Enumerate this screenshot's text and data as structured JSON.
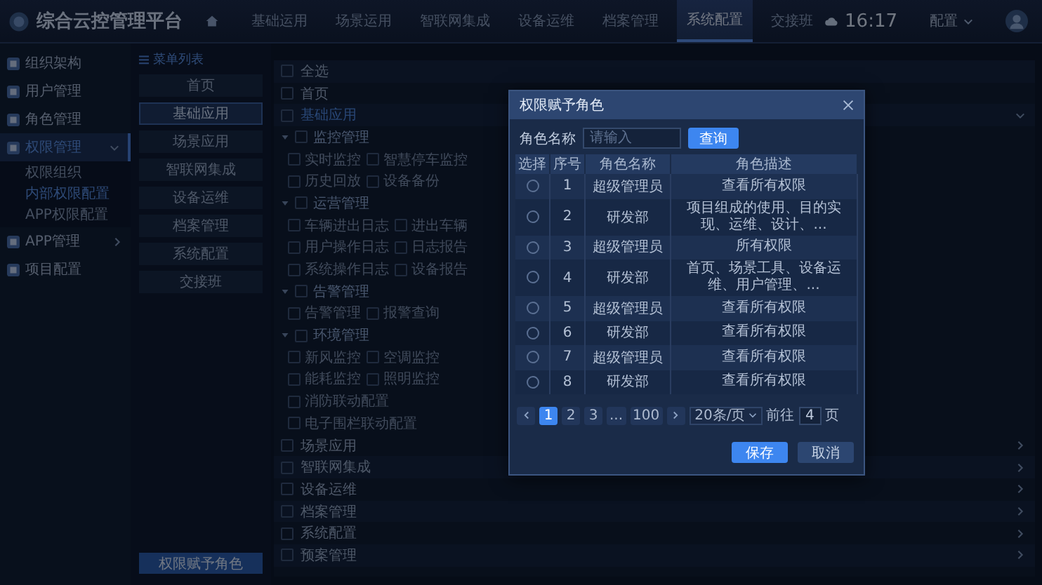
{
  "header": {
    "logo": "综合云控管理平台",
    "nav": [
      {
        "label": "基础运用",
        "selected": false
      },
      {
        "label": "场景运用",
        "selected": false
      },
      {
        "label": "智联网集成",
        "selected": false
      },
      {
        "label": "设备运维",
        "selected": false
      },
      {
        "label": "档案管理",
        "selected": false
      },
      {
        "label": "系统配置",
        "selected": true
      },
      {
        "label": "交接班",
        "selected": false
      }
    ],
    "time": "16:17",
    "user_menu": "配置"
  },
  "sidebar": {
    "items": [
      {
        "label": "组织架构",
        "selected": false
      },
      {
        "label": "用户管理",
        "selected": false
      },
      {
        "label": "角色管理",
        "selected": false
      },
      {
        "label": "权限管理",
        "selected": true,
        "expanded": true,
        "children": [
          {
            "label": "权限组织",
            "selected": false
          },
          {
            "label": "内部权限配置",
            "selected": true
          },
          {
            "label": "APP权限配置",
            "selected": false
          }
        ]
      },
      {
        "label": "APP管理",
        "selected": false,
        "expanded": false
      },
      {
        "label": "项目配置",
        "selected": false
      }
    ]
  },
  "menu_list": {
    "title": "菜单列表",
    "items": [
      {
        "label": "首页",
        "selected": false
      },
      {
        "label": "基础应用",
        "selected": true
      },
      {
        "label": "场景应用",
        "selected": false
      },
      {
        "label": "智联网集成",
        "selected": false
      },
      {
        "label": "设备运维",
        "selected": false
      },
      {
        "label": "档案管理",
        "selected": false
      },
      {
        "label": "系统配置",
        "selected": false
      },
      {
        "label": "交接班",
        "selected": false
      }
    ],
    "assign_button": "权限赋予角色"
  },
  "permissions": {
    "rows": [
      {
        "kind": "plain",
        "label": "全选",
        "checked": false
      },
      {
        "kind": "plain",
        "label": "首页",
        "checked": false
      },
      {
        "kind": "module",
        "label": "基础应用",
        "checked": false,
        "expanded": true,
        "groups": [
          {
            "label": "监控管理",
            "checked": false,
            "expanded": true,
            "lines": [
              {
                "items": [
                  {
                    "label": "实时监控",
                    "checked": false
                  },
                  {
                    "label": "智慧停车监控",
                    "checked": false
                  }
                ]
              },
              {
                "items": [
                  {
                    "label": "历史回放",
                    "checked": false
                  },
                  {
                    "label": "设备备份",
                    "checked": false
                  }
                ]
              }
            ]
          },
          {
            "label": "运营管理",
            "checked": false,
            "expanded": true,
            "lines": [
              {
                "items": [
                  {
                    "label": "车辆进出日志",
                    "checked": false
                  },
                  {
                    "label": "进出车辆",
                    "checked": false
                  }
                ]
              },
              {
                "items": [
                  {
                    "label": "用户操作日志",
                    "checked": false
                  },
                  {
                    "label": "日志报告",
                    "checked": false
                  }
                ]
              },
              {
                "items": [
                  {
                    "label": "系统操作日志",
                    "checked": false
                  },
                  {
                    "label": "设备报告",
                    "checked": false
                  }
                ]
              }
            ]
          },
          {
            "label": "告警管理",
            "checked": false,
            "expanded": true,
            "lines": [
              {
                "items": [
                  {
                    "label": "告警管理",
                    "checked": false
                  },
                  {
                    "label": "报警查询",
                    "checked": false
                  }
                ]
              }
            ]
          },
          {
            "label": "环境管理",
            "checked": false,
            "expanded": true,
            "lines": [
              {
                "items": [
                  {
                    "label": "新风监控",
                    "checked": false
                  },
                  {
                    "label": "空调监控",
                    "checked": false
                  }
                ]
              },
              {
                "items": [
                  {
                    "label": "能耗监控",
                    "checked": false
                  },
                  {
                    "label": "照明监控",
                    "checked": false
                  }
                ]
              },
              {
                "items": [
                  {
                    "label": "消防联动配置",
                    "checked": false
                  }
                ]
              },
              {
                "items": [
                  {
                    "label": "电子围栏联动配置",
                    "checked": false
                  }
                ]
              }
            ]
          }
        ]
      },
      {
        "kind": "module",
        "label": "场景应用",
        "checked": false,
        "expanded": false
      },
      {
        "kind": "module",
        "label": "智联网集成",
        "checked": false,
        "expanded": false
      },
      {
        "kind": "module",
        "label": "设备运维",
        "checked": false,
        "expanded": false
      },
      {
        "kind": "module",
        "label": "档案管理",
        "checked": false,
        "expanded": false
      },
      {
        "kind": "module",
        "label": "系统配置",
        "checked": false,
        "expanded": false
      },
      {
        "kind": "module",
        "label": "预案管理",
        "checked": false,
        "expanded": false
      }
    ]
  },
  "dialog": {
    "title": "权限赋予角色",
    "search": {
      "label": "角色名称",
      "placeholder": "请输入",
      "button": "查询"
    },
    "table": {
      "columns": [
        "选择",
        "序号",
        "角色名称",
        "角色描述"
      ],
      "rows": [
        {
          "selected": false,
          "cells": [
            "",
            "1",
            "超级管理员",
            "查看所有权限"
          ]
        },
        {
          "selected": false,
          "cells": [
            "",
            "2",
            "研发部",
            "项目组成的使用、目的实现、运维、设计、..."
          ]
        },
        {
          "selected": false,
          "cells": [
            "",
            "3",
            "超级管理员",
            "所有权限"
          ]
        },
        {
          "selected": false,
          "cells": [
            "",
            "4",
            "研发部",
            "首页、场景工具、设备运维、用户管理、..."
          ]
        },
        {
          "selected": false,
          "cells": [
            "",
            "5",
            "超级管理员",
            "查看所有权限"
          ]
        },
        {
          "selected": false,
          "cells": [
            "",
            "6",
            "研发部",
            "查看所有权限"
          ]
        },
        {
          "selected": false,
          "cells": [
            "",
            "7",
            "超级管理员",
            "查看所有权限"
          ]
        },
        {
          "selected": false,
          "cells": [
            "",
            "8",
            "研发部",
            "查看所有权限"
          ]
        }
      ]
    },
    "pagination": {
      "pages": [
        {
          "label": "1",
          "selected": true
        },
        {
          "label": "2",
          "selected": false
        },
        {
          "label": "3",
          "selected": false
        },
        {
          "label": "...",
          "selected": false
        },
        {
          "label": "100",
          "selected": false
        }
      ],
      "page_size": "20条/页",
      "goto_label": "前往",
      "goto_value": "4",
      "goto_suffix": "页"
    },
    "buttons": [
      {
        "label": "保存",
        "kind": "primary"
      },
      {
        "label": "取消",
        "kind": "secondary"
      }
    ]
  }
}
